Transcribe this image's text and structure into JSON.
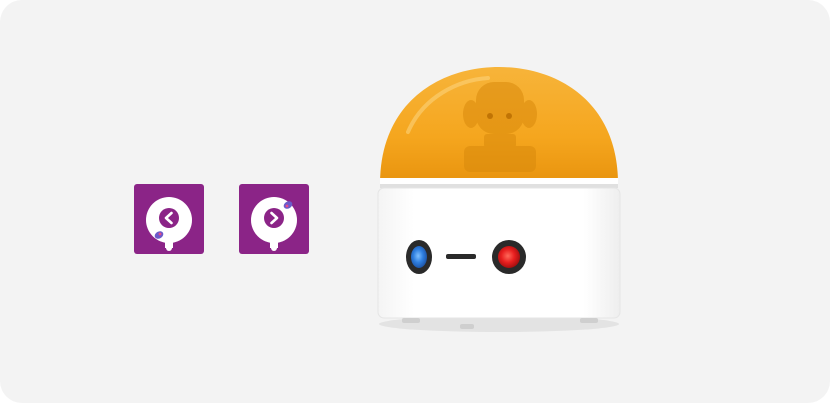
{
  "scene": {
    "background": "#f3f3f3"
  },
  "cards": [
    {
      "name": "turn-left-card",
      "icon": "turn-left-arrow-icon",
      "color": "#8b2487"
    },
    {
      "name": "turn-right-card",
      "icon": "turn-right-arrow-icon",
      "color": "#8b2487"
    }
  ],
  "robot": {
    "dome_color": "#f5a61e",
    "body_color": "#ffffff",
    "left_eye_color": "#2f7fe0",
    "right_eye_color": "#e81f1f"
  }
}
